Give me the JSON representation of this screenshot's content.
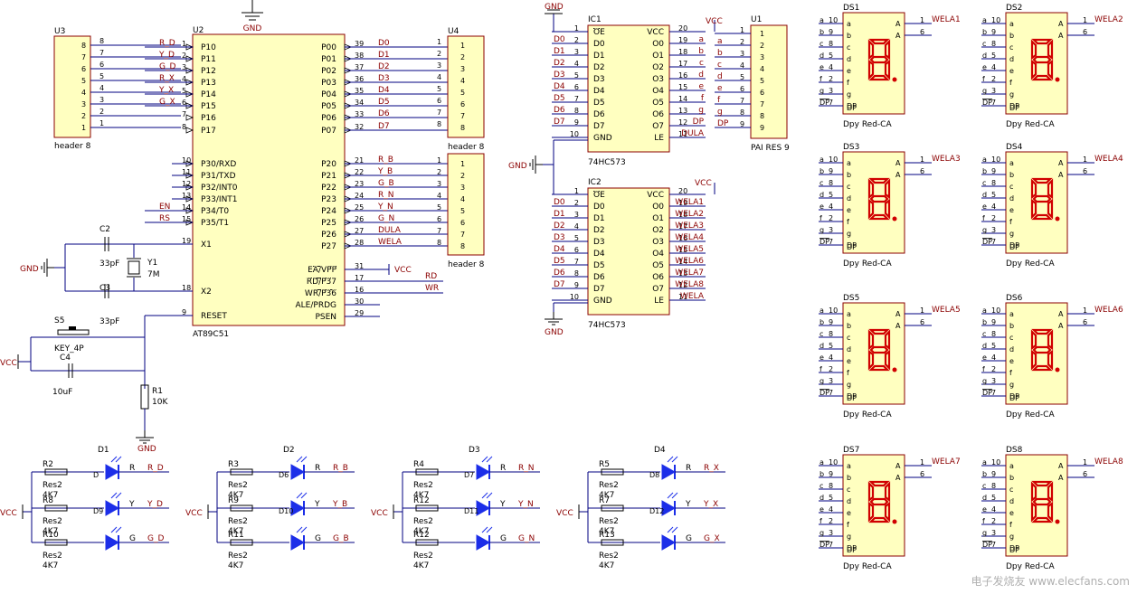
{
  "colors": {
    "body_fill": "#ffffc0",
    "body_stroke": "#8b0000",
    "wire": "#000080",
    "led": "#1c2ee8",
    "seg": "#d00000",
    "net": "#8b0000"
  },
  "power": {
    "gnd": "GND",
    "vcc": "VCC"
  },
  "u3": {
    "ref": "U3",
    "name": "header 8",
    "pins": [
      "8",
      "7",
      "6",
      "5",
      "4",
      "3",
      "2",
      "1"
    ],
    "wirenums": [
      "8",
      "7",
      "6",
      "5",
      "4",
      "3",
      "2",
      "1"
    ]
  },
  "u2": {
    "ref": "U2",
    "name": "AT89C51",
    "left_pins": [
      {
        "num": "1",
        "name": "P10",
        "net": "R_D"
      },
      {
        "num": "2",
        "name": "P11",
        "net": "Y_D"
      },
      {
        "num": "3",
        "name": "P12",
        "net": "G_D"
      },
      {
        "num": "4",
        "name": "P13",
        "net": "R_X"
      },
      {
        "num": "5",
        "name": "P14",
        "net": "Y_X"
      },
      {
        "num": "6",
        "name": "P15",
        "net": "G_X"
      },
      {
        "num": "7",
        "name": "P16",
        "net": ""
      },
      {
        "num": "8",
        "name": "P17",
        "net": ""
      },
      {
        "num": "10",
        "name": "P30/RXD",
        "net": ""
      },
      {
        "num": "11",
        "name": "P31/TXD",
        "net": ""
      },
      {
        "num": "12",
        "name": "P32/INT0",
        "net": ""
      },
      {
        "num": "13",
        "name": "P33/INT1",
        "net": ""
      },
      {
        "num": "14",
        "name": "P34/T0",
        "net": "EN"
      },
      {
        "num": "15",
        "name": "P35/T1",
        "net": "RS"
      },
      {
        "num": "19",
        "name": "X1",
        "net": ""
      },
      {
        "num": "18",
        "name": "X2",
        "net": ""
      },
      {
        "num": "9",
        "name": "RESET",
        "net": ""
      }
    ],
    "right_pins": [
      {
        "num": "39",
        "name": "P00",
        "net": "D0"
      },
      {
        "num": "38",
        "name": "P01",
        "net": "D1"
      },
      {
        "num": "37",
        "name": "P02",
        "net": "D2"
      },
      {
        "num": "36",
        "name": "P03",
        "net": "D3"
      },
      {
        "num": "35",
        "name": "P04",
        "net": "D4"
      },
      {
        "num": "34",
        "name": "P05",
        "net": "D5"
      },
      {
        "num": "33",
        "name": "P06",
        "net": "D6"
      },
      {
        "num": "32",
        "name": "P07",
        "net": "D7"
      },
      {
        "num": "21",
        "name": "P20",
        "net": "R_B"
      },
      {
        "num": "22",
        "name": "P21",
        "net": "Y_B"
      },
      {
        "num": "23",
        "name": "P22",
        "net": "G_B"
      },
      {
        "num": "24",
        "name": "P23",
        "net": "R_N"
      },
      {
        "num": "25",
        "name": "P24",
        "net": "Y_N"
      },
      {
        "num": "26",
        "name": "P25",
        "net": "G_N"
      },
      {
        "num": "27",
        "name": "P26",
        "net": "DULA"
      },
      {
        "num": "28",
        "name": "P27",
        "net": "WELA"
      },
      {
        "num": "31",
        "name": "EA/VPP",
        "net": "VCC"
      },
      {
        "num": "17",
        "name": "RD/P37",
        "net": "RD"
      },
      {
        "num": "16",
        "name": "WR/P36",
        "net": "WR"
      },
      {
        "num": "30",
        "name": "ALE/PRDG",
        "net": ""
      },
      {
        "num": "29",
        "name": "PSEN",
        "net": ""
      }
    ]
  },
  "u4": {
    "ref": "U4",
    "name": "header 8",
    "pins": [
      "1",
      "2",
      "3",
      "4",
      "5",
      "6",
      "7",
      "8"
    ]
  },
  "u5": {
    "name": "header 8",
    "pins": [
      "1",
      "2",
      "3",
      "4",
      "5",
      "6",
      "7",
      "8"
    ]
  },
  "crystal": {
    "c2": "C2",
    "c2v": "33pF",
    "c3": "C3",
    "c3v": "33pF",
    "y1": "Y1",
    "y1v": "7M"
  },
  "reset": {
    "s5": "S5",
    "s5v": "KEY_4P",
    "c4": "C4",
    "c4v": "10uF",
    "r1": "R1",
    "r1v": "10K"
  },
  "ic1": {
    "ref": "IC1",
    "name": "74HC573",
    "left": [
      {
        "num": "1",
        "name": "OE",
        "net": ""
      },
      {
        "num": "2",
        "name": "D0",
        "net": "D0"
      },
      {
        "num": "3",
        "name": "D1",
        "net": "D1"
      },
      {
        "num": "4",
        "name": "D2",
        "net": "D2"
      },
      {
        "num": "5",
        "name": "D3",
        "net": "D3"
      },
      {
        "num": "6",
        "name": "D4",
        "net": "D4"
      },
      {
        "num": "7",
        "name": "D5",
        "net": "D5"
      },
      {
        "num": "8",
        "name": "D6",
        "net": "D6"
      },
      {
        "num": "9",
        "name": "D7",
        "net": "D7"
      },
      {
        "num": "10",
        "name": "GND",
        "net": ""
      }
    ],
    "right": [
      {
        "num": "20",
        "name": "VCC",
        "net": ""
      },
      {
        "num": "19",
        "name": "O0",
        "net": "a"
      },
      {
        "num": "18",
        "name": "O1",
        "net": "b"
      },
      {
        "num": "17",
        "name": "O2",
        "net": "c"
      },
      {
        "num": "16",
        "name": "O3",
        "net": "d"
      },
      {
        "num": "15",
        "name": "O4",
        "net": "e"
      },
      {
        "num": "14",
        "name": "O5",
        "net": "f"
      },
      {
        "num": "13",
        "name": "O6",
        "net": "g"
      },
      {
        "num": "12",
        "name": "O7",
        "net": "DP"
      },
      {
        "num": "11",
        "name": "LE",
        "net": "DULA"
      }
    ]
  },
  "ic2": {
    "ref": "IC2",
    "name": "74HC573",
    "left": [
      {
        "num": "1",
        "name": "OE",
        "net": ""
      },
      {
        "num": "2",
        "name": "D0",
        "net": "D0"
      },
      {
        "num": "3",
        "name": "D1",
        "net": "D1"
      },
      {
        "num": "4",
        "name": "D2",
        "net": "D2"
      },
      {
        "num": "5",
        "name": "D3",
        "net": "D3"
      },
      {
        "num": "6",
        "name": "D4",
        "net": "D4"
      },
      {
        "num": "7",
        "name": "D5",
        "net": "D5"
      },
      {
        "num": "8",
        "name": "D6",
        "net": "D6"
      },
      {
        "num": "9",
        "name": "D7",
        "net": "D7"
      },
      {
        "num": "10",
        "name": "GND",
        "net": ""
      }
    ],
    "right": [
      {
        "num": "20",
        "name": "VCC",
        "net": ""
      },
      {
        "num": "19",
        "name": "O0",
        "net": "WELA1"
      },
      {
        "num": "18",
        "name": "O1",
        "net": "WELA2"
      },
      {
        "num": "17",
        "name": "O2",
        "net": "WELA3"
      },
      {
        "num": "16",
        "name": "O3",
        "net": "WELA4"
      },
      {
        "num": "15",
        "name": "O4",
        "net": "WELA5"
      },
      {
        "num": "14",
        "name": "O5",
        "net": "WELA6"
      },
      {
        "num": "13",
        "name": "O6",
        "net": "WELA7"
      },
      {
        "num": "12",
        "name": "O7",
        "net": "WELA8"
      },
      {
        "num": "11",
        "name": "LE",
        "net": "WELA"
      }
    ]
  },
  "u1": {
    "ref": "U1",
    "name": "PAI RES 9",
    "pins": [
      "1",
      "2",
      "3",
      "4",
      "5",
      "6",
      "7",
      "8",
      "9"
    ],
    "nets": [
      "VCC",
      "a",
      "b",
      "c",
      "d",
      "e",
      "f",
      "g",
      "DP"
    ]
  },
  "displays": {
    "type": "Dpy Red-CA",
    "refs": [
      "DS1",
      "DS2",
      "DS3",
      "DS4",
      "DS5",
      "DS6",
      "DS7",
      "DS8"
    ],
    "wela": [
      "WELA1",
      "WELA2",
      "WELA3",
      "WELA4",
      "WELA5",
      "WELA6",
      "WELA7",
      "WELA8"
    ],
    "pins": [
      {
        "net": "a",
        "num": "10",
        "label": "a"
      },
      {
        "net": "b",
        "num": "9",
        "label": "b"
      },
      {
        "net": "c",
        "num": "8",
        "label": "c"
      },
      {
        "net": "d",
        "num": "5",
        "label": "d"
      },
      {
        "net": "e",
        "num": "4",
        "label": "e"
      },
      {
        "net": "f",
        "num": "2",
        "label": "f"
      },
      {
        "net": "g",
        "num": "3",
        "label": "g"
      },
      {
        "net": "DP",
        "num": "7",
        "label": "DP"
      }
    ],
    "apins": [
      "1",
      "6"
    ],
    "alabel": "A"
  },
  "leds": [
    {
      "ref": "D1",
      "rows": [
        {
          "r": "R2",
          "d": "D",
          "c": "R",
          "net": "R_D"
        },
        {
          "r": "R8",
          "d": "D9",
          "c": "Y",
          "net": "Y_D"
        },
        {
          "r": "R10",
          "d": "",
          "c": "G",
          "net": "G_D"
        }
      ]
    },
    {
      "ref": "D2",
      "rows": [
        {
          "r": "R3",
          "d": "D6",
          "c": "R",
          "net": "R_B"
        },
        {
          "r": "R9",
          "d": "D10",
          "c": "Y",
          "net": "Y_B"
        },
        {
          "r": "R11",
          "d": "",
          "c": "G",
          "net": "G_B"
        }
      ]
    },
    {
      "ref": "D3",
      "rows": [
        {
          "r": "R4",
          "d": "D7",
          "c": "R",
          "net": "R_N"
        },
        {
          "r": "R12",
          "d": "D11",
          "c": "Y",
          "net": "Y_N"
        },
        {
          "r": "R12",
          "d": "",
          "c": "G",
          "net": "G_N"
        }
      ]
    },
    {
      "ref": "D4",
      "rows": [
        {
          "r": "R5",
          "d": "D8",
          "c": "R",
          "net": "R_X"
        },
        {
          "r": "R7",
          "d": "D12",
          "c": "Y",
          "net": "Y_X"
        },
        {
          "r": "R13",
          "d": "",
          "c": "G",
          "net": "G_X"
        }
      ]
    }
  ],
  "res_labels": {
    "type": "Res2",
    "value": "4K7"
  },
  "watermark": "电子发烧友 www.elecfans.com"
}
